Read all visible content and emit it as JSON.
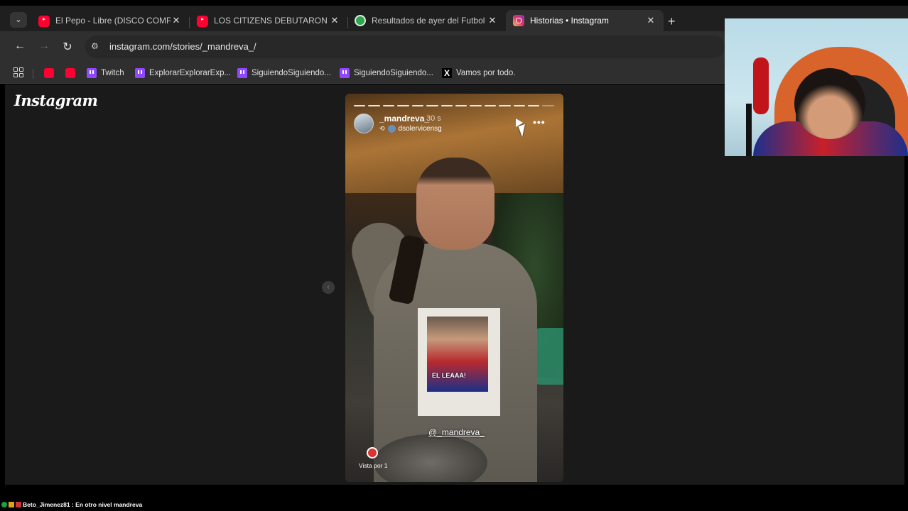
{
  "tabs": [
    {
      "title": "El Pepo - Libre (DISCO COMPLETO",
      "favicon": "youtube-icon",
      "active": false
    },
    {
      "title": "LOS CITIZENS DEBUTARON CON",
      "favicon": "youtube-icon",
      "active": false
    },
    {
      "title": "Resultados de ayer del Futbol A",
      "favicon": "soccer-ball-icon",
      "active": false
    },
    {
      "title": "Historias • Instagram",
      "favicon": "instagram-icon",
      "active": true
    }
  ],
  "toolbar": {
    "url": "instagram.com/stories/_mandreva_/"
  },
  "bookmarks": [
    {
      "label": "",
      "icon": "youtube-icon"
    },
    {
      "label": "",
      "icon": "youtube-icon"
    },
    {
      "label": "Twitch",
      "icon": "twitch-icon"
    },
    {
      "label": "ExplorarExplorarExp...",
      "icon": "twitch-icon"
    },
    {
      "label": "SiguiendoSiguiendo...",
      "icon": "twitch-icon"
    },
    {
      "label": "SiguiendoSiguiendo...",
      "icon": "twitch-icon"
    },
    {
      "label": "Vamos por todo.",
      "icon": "x-icon"
    }
  ],
  "page": {
    "logo": "Instagram"
  },
  "story": {
    "username": "_mandreva_",
    "time": "30 s",
    "reposted_from": "dsolervicensg",
    "paper_caption": "EL LEAAA!",
    "mention": "@_mandreva_",
    "viewers": "Vista por 1",
    "progress": {
      "segments": 14,
      "filled": 13
    }
  },
  "chat": {
    "message": "Beto_Jimenez81 : En otro nivel mandreva"
  },
  "colors": {
    "background": "#000000",
    "page": "#1a1a1a",
    "toolbar": "#2f2f2f",
    "tabstrip": "#1f1f1f"
  }
}
